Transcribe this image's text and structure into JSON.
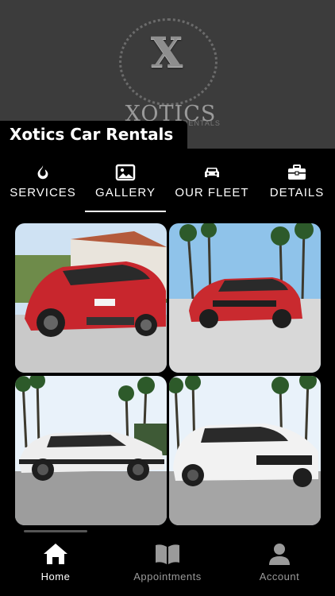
{
  "header": {
    "brand_logo_text": "XOTICS",
    "brand_logo_sub": "RENTALS",
    "title": "Xotics Car Rentals"
  },
  "tabs": [
    {
      "label": "SERVICES",
      "icon": "flame-icon",
      "active": false
    },
    {
      "label": "GALLERY",
      "icon": "image-icon",
      "active": true
    },
    {
      "label": "OUR FLEET",
      "icon": "car-icon",
      "active": false
    },
    {
      "label": "DETAILS",
      "icon": "briefcase-icon",
      "active": false
    }
  ],
  "gallery": {
    "photos": [
      {
        "subject": "red SUV coupe rear view",
        "color": "#c8262d"
      },
      {
        "subject": "red SUV front view with palm trees",
        "color": "#c92a2f"
      },
      {
        "subject": "white SUV side view with palm trees",
        "color": "#eeeeee"
      },
      {
        "subject": "white SUV front view",
        "color": "#f2f2f2"
      }
    ]
  },
  "bottom_nav": [
    {
      "label": "Home",
      "icon": "home-icon",
      "active": true
    },
    {
      "label": "Appointments",
      "icon": "book-icon",
      "active": false
    },
    {
      "label": "Account",
      "icon": "person-icon",
      "active": false
    }
  ],
  "colors": {
    "hero_bg": "#3c3c3c",
    "active_text": "#ffffff",
    "inactive_text": "#9a9a9a",
    "background": "#000000"
  }
}
